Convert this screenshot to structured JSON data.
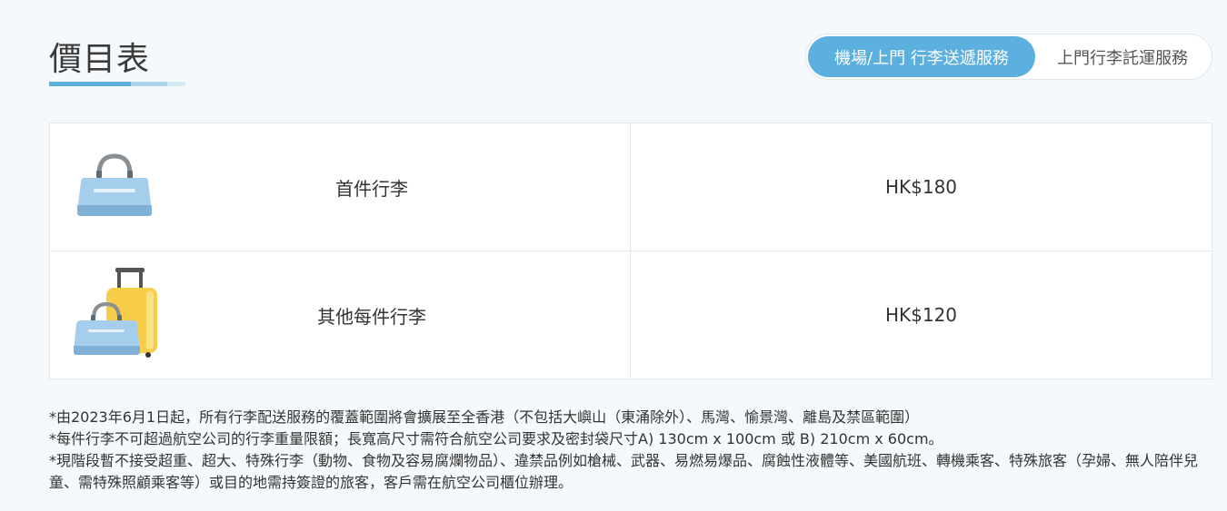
{
  "header": {
    "title": "價目表"
  },
  "service_toggle": {
    "active_label": "機場/上門 行李送遞服務",
    "inactive_label": "上門行李託運服務"
  },
  "price_table": {
    "rows": [
      {
        "item": "首件行李",
        "price": "HK$180",
        "icon": "handbag-icon"
      },
      {
        "item": "其他每件行李",
        "price": "HK$120",
        "icon": "suitcase-and-handbag-icon"
      }
    ]
  },
  "notes": [
    "*由2023年6月1日起，所有行李配送服務的覆蓋範圍將會擴展至全香港（不包括大嶼山（東涌除外）、馬灣、愉景灣、離島及禁區範圍）",
    "*每件行李不可超過航空公司的行李重量限額；長寬高尺寸需符合航空公司要求及密封袋尺寸A) 130cm x 100cm 或 B) 210cm x 60cm。",
    "*現階段暫不接受超重、超大、特殊行李（動物、食物及容易腐爛物品）、違禁品例如槍械、武器、易燃易爆品、腐蝕性液體等、美國航班、轉機乘客、特殊旅客（孕婦、無人陪伴兒童、需特殊照顧乘客等）或目的地需持簽證的旅客，客戶需在航空公司櫃位辦理。"
  ],
  "colors": {
    "accent": "#5bb0e0",
    "background": "#f5f9fc"
  }
}
